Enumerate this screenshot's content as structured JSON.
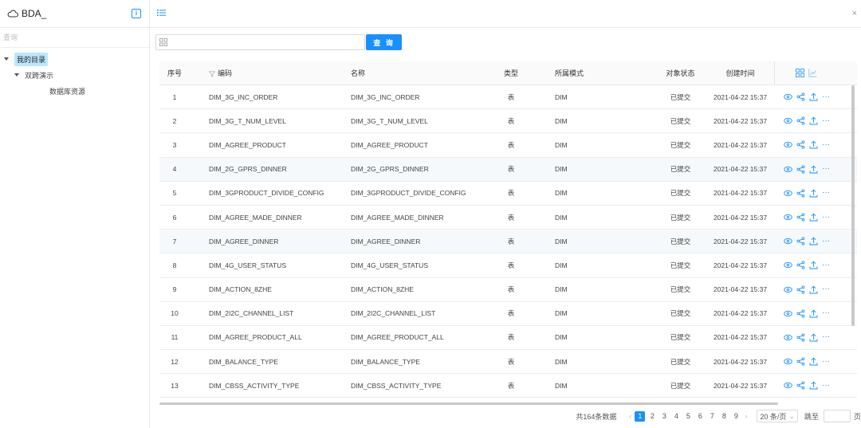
{
  "app": {
    "title": "BDA_"
  },
  "sidebar": {
    "search_placeholder": "查询",
    "tree": {
      "root": "我的目录",
      "child": "双跨演示",
      "leaf": "数据库资源"
    }
  },
  "main": {
    "query_button": "查 询",
    "columns": {
      "no": "序号",
      "code": "编码",
      "name": "名称",
      "type": "类型",
      "mode": "所属模式",
      "state": "对象状态",
      "created": "创建时间"
    },
    "rows": [
      {
        "no": "1",
        "code": "DIM_3G_INC_ORDER",
        "name": "DIM_3G_INC_ORDER",
        "type": "表",
        "mode": "DIM",
        "state": "已提交",
        "created": "2021-04-22 15:37"
      },
      {
        "no": "2",
        "code": "DIM_3G_T_NUM_LEVEL",
        "name": "DIM_3G_T_NUM_LEVEL",
        "type": "表",
        "mode": "DIM",
        "state": "已提交",
        "created": "2021-04-22 15:37"
      },
      {
        "no": "3",
        "code": "DIM_AGREE_PRODUCT",
        "name": "DIM_AGREE_PRODUCT",
        "type": "表",
        "mode": "DIM",
        "state": "已提交",
        "created": "2021-04-22 15:37"
      },
      {
        "no": "4",
        "code": "DIM_2G_GPRS_DINNER",
        "name": "DIM_2G_GPRS_DINNER",
        "type": "表",
        "mode": "DIM",
        "state": "已提交",
        "created": "2021-04-22 15:37"
      },
      {
        "no": "5",
        "code": "DIM_3GPRODUCT_DIVIDE_CONFIG",
        "name": "DIM_3GPRODUCT_DIVIDE_CONFIG",
        "type": "表",
        "mode": "DIM",
        "state": "已提交",
        "created": "2021-04-22 15:37"
      },
      {
        "no": "6",
        "code": "DIM_AGREE_MADE_DINNER",
        "name": "DIM_AGREE_MADE_DINNER",
        "type": "表",
        "mode": "DIM",
        "state": "已提交",
        "created": "2021-04-22 15:37"
      },
      {
        "no": "7",
        "code": "DIM_AGREE_DINNER",
        "name": "DIM_AGREE_DINNER",
        "type": "表",
        "mode": "DIM",
        "state": "已提交",
        "created": "2021-04-22 15:37"
      },
      {
        "no": "8",
        "code": "DIM_4G_USER_STATUS",
        "name": "DIM_4G_USER_STATUS",
        "type": "表",
        "mode": "DIM",
        "state": "已提交",
        "created": "2021-04-22 15:37"
      },
      {
        "no": "9",
        "code": "DIM_ACTION_8ZHE",
        "name": "DIM_ACTION_8ZHE",
        "type": "表",
        "mode": "DIM",
        "state": "已提交",
        "created": "2021-04-22 15:37"
      },
      {
        "no": "10",
        "code": "DIM_2I2C_CHANNEL_LIST",
        "name": "DIM_2I2C_CHANNEL_LIST",
        "type": "表",
        "mode": "DIM",
        "state": "已提交",
        "created": "2021-04-22 15:37"
      },
      {
        "no": "11",
        "code": "DIM_AGREE_PRODUCT_ALL",
        "name": "DIM_AGREE_PRODUCT_ALL",
        "type": "表",
        "mode": "DIM",
        "state": "已提交",
        "created": "2021-04-22 15:37"
      },
      {
        "no": "12",
        "code": "DIM_BALANCE_TYPE",
        "name": "DIM_BALANCE_TYPE",
        "type": "表",
        "mode": "DIM",
        "state": "已提交",
        "created": "2021-04-22 15:37"
      },
      {
        "no": "13",
        "code": "DIM_CBSS_ACTIVITY_TYPE",
        "name": "DIM_CBSS_ACTIVITY_TYPE",
        "type": "表",
        "mode": "DIM",
        "state": "已提交",
        "created": "2021-04-22 15:37"
      }
    ],
    "pagination": {
      "total": "共164条数据",
      "pages": [
        "1",
        "2",
        "3",
        "4",
        "5",
        "6",
        "7",
        "8",
        "9"
      ],
      "current": "1",
      "prev": "‹",
      "next": "›",
      "page_size": "20 条/页",
      "jump_label": "跳至",
      "page_suffix": "页"
    }
  },
  "colors": {
    "accent": "#1890ff",
    "tree_selected": "#bae7ff"
  },
  "icons": [
    "cloud-icon",
    "info-icon",
    "list-icon",
    "close-icon",
    "grid-icon",
    "filter-icon",
    "view-icon",
    "share-icon",
    "upload-icon",
    "more-icon",
    "chart-icon"
  ]
}
